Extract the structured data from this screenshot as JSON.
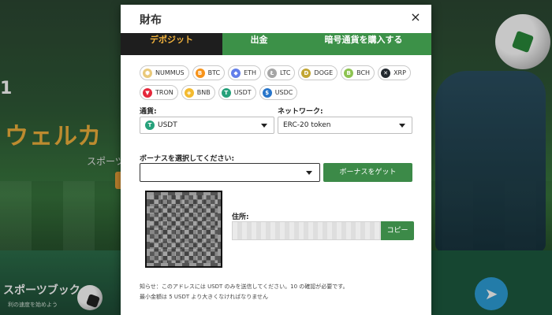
{
  "background": {
    "line1": "1",
    "title": "ウェルカ",
    "subtitle": "スポーツ",
    "sports_title": "スポーツブック",
    "sports_sub": "利の速度を始めよう"
  },
  "modal": {
    "title": "財布",
    "close_glyph": "×",
    "tabs": [
      {
        "label": "デポジット",
        "active": true
      },
      {
        "label": "出金",
        "active": false
      },
      {
        "label": "暗号通貨を購入する",
        "active": false
      }
    ],
    "coins_row1": [
      {
        "label": "NUMMUS",
        "icon": "nummus-icon",
        "color": "#e9c97a",
        "glyph": "⬢"
      },
      {
        "label": "BTC",
        "icon": "btc-icon",
        "color": "#f7931a",
        "glyph": "B"
      },
      {
        "label": "ETH",
        "icon": "eth-icon",
        "color": "#627eea",
        "glyph": "◆"
      },
      {
        "label": "LTC",
        "icon": "ltc-icon",
        "color": "#a5a5a5",
        "glyph": "Ł"
      },
      {
        "label": "DOGE",
        "icon": "doge-icon",
        "color": "#c2a633",
        "glyph": "D"
      },
      {
        "label": "BCH",
        "icon": "bch-icon",
        "color": "#8dc351",
        "glyph": "B"
      },
      {
        "label": "XRP",
        "icon": "xrp-icon",
        "color": "#23292f",
        "glyph": "✕"
      }
    ],
    "coins_row2": [
      {
        "label": "TRON",
        "icon": "tron-icon",
        "color": "#e5283b",
        "glyph": "▼"
      },
      {
        "label": "BNB",
        "icon": "bnb-icon",
        "color": "#f3ba2f",
        "glyph": "◈"
      },
      {
        "label": "USDT",
        "icon": "usdt-icon",
        "color": "#26a17b",
        "glyph": "T"
      },
      {
        "label": "USDC",
        "icon": "usdc-icon",
        "color": "#2775ca",
        "glyph": "$"
      }
    ],
    "currency_label": "通貨:",
    "currency_value": "USDT",
    "network_label": "ネットワーク:",
    "network_value": "ERC-20 token",
    "bonus_label": "ボーナスを選択してください:",
    "bonus_value": "",
    "bonus_button": "ボーナスをゲット",
    "address_label": "住所:",
    "copy_button": "コピー",
    "notice_line1": "知らせ：このアドレスには USDT のみを送信してください。10 の確認が必要です。",
    "notice_line2": "最小金額は 5 USDT より大きくなければなりません"
  },
  "colors": {
    "accent_green": "#3c8a48",
    "tab_active_bg": "#1e1e1e",
    "tab_active_text": "#f2b33d"
  }
}
